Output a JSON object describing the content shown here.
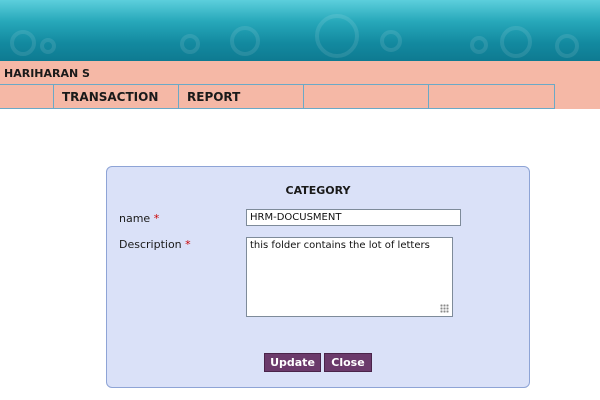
{
  "header": {
    "username": "HARIHARAN S"
  },
  "nav": {
    "items": [
      "",
      "TRANSACTION",
      "REPORT",
      "",
      ""
    ]
  },
  "panel": {
    "title": "CATEGORY",
    "name_label": "name",
    "description_label": "Description",
    "required_marker": "*",
    "name_value": "HRM-DOCUSMENT",
    "description_value": "this folder contains the lot of letters",
    "update_label": "Update",
    "close_label": "Close"
  },
  "colors": {
    "banner": "#1f9cb2",
    "menu_background": "#f5b8a6",
    "panel_background": "#dae1f8",
    "button_background": "#6b3a6b",
    "required": "#cc0000"
  }
}
